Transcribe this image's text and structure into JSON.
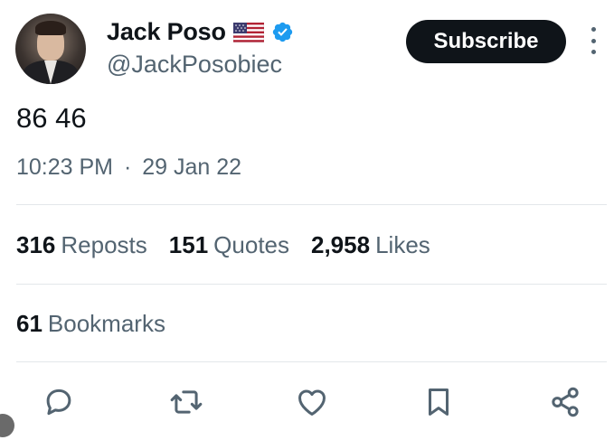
{
  "author": {
    "display_name": "Jack Poso",
    "handle": "@JackPosobiec",
    "flag": "🇺🇸",
    "verified": true
  },
  "subscribe_label": "Subscribe",
  "tweet": {
    "text": "86 46",
    "time": "10:23 PM",
    "separator": "·",
    "date": "29 Jan 22"
  },
  "stats": {
    "reposts_count": "316",
    "reposts_label": "Reposts",
    "quotes_count": "151",
    "quotes_label": "Quotes",
    "likes_count": "2,958",
    "likes_label": "Likes",
    "bookmarks_count": "61",
    "bookmarks_label": "Bookmarks"
  },
  "colors": {
    "primary_text": "#0f1419",
    "secondary_text": "#536471",
    "verified_blue": "#1d9bf0",
    "button_bg": "#0f1419",
    "divider": "#e3e7ea"
  },
  "icons": [
    "more-icon",
    "verified-icon",
    "flag-icon",
    "reply-icon",
    "repost-icon",
    "like-icon",
    "bookmark-icon",
    "share-icon"
  ]
}
